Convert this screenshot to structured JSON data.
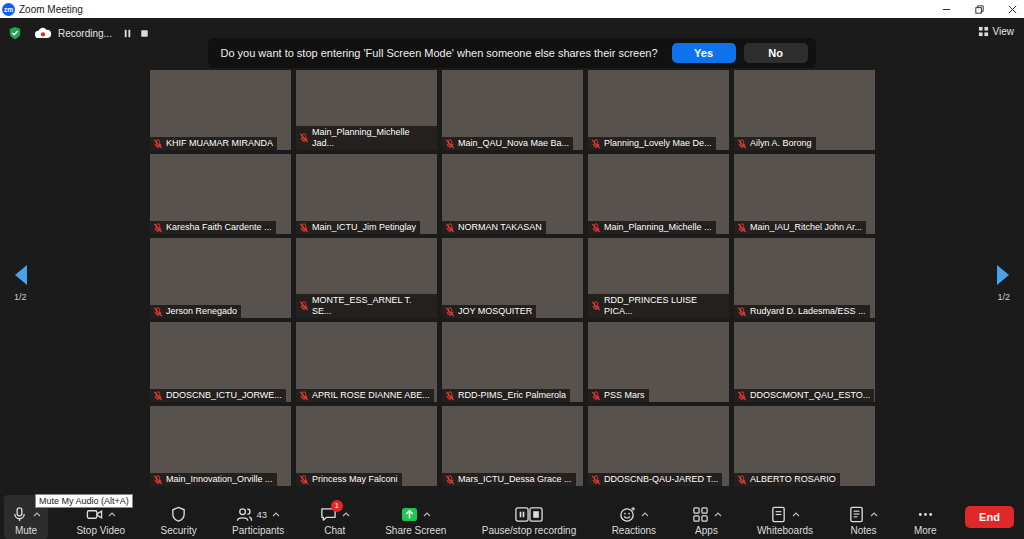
{
  "window": {
    "title": "Zoom Meeting",
    "logo": "zm"
  },
  "recording": {
    "label": "Recording..."
  },
  "banner": {
    "message": "Do you want to stop entering 'Full Screen Mode' when someone else shares their screen?",
    "buttons": [
      {
        "label": "Yes",
        "primary": true
      },
      {
        "label": "No",
        "primary": false
      }
    ]
  },
  "view": {
    "label": "View"
  },
  "pager": {
    "left": "1/2",
    "right": "1/2"
  },
  "tiles": [
    {
      "name": "KHIF MUAMAR MIRANDA",
      "muted": true
    },
    {
      "name": "Main_Planning_Michelle Jad...",
      "muted": true
    },
    {
      "name": "Main_QAU_Nova Mae Ba...",
      "muted": true
    },
    {
      "name": "Planning_Lovely Mae De...",
      "muted": true
    },
    {
      "name": "Ailyn A. Borong",
      "muted": true
    },
    {
      "name": "Karesha Faith Cardente ...",
      "muted": true
    },
    {
      "name": "Main_ICTU_Jim Petinglay",
      "muted": true
    },
    {
      "name": "NORMAN TAKASAN",
      "muted": true
    },
    {
      "name": "Main_Planning_Michelle ...",
      "muted": true
    },
    {
      "name": "Main_IAU_Ritchel John Ar...",
      "muted": true
    },
    {
      "name": "Jerson Renegado",
      "muted": true
    },
    {
      "name": "MONTE_ESS_ARNEL T. SE...",
      "muted": true
    },
    {
      "name": "JOY MOSQUITER",
      "muted": true
    },
    {
      "name": "RDD_PRINCES LUISE PICA...",
      "muted": true
    },
    {
      "name": "Rudyard D. Ladesma/ESS ...",
      "muted": true
    },
    {
      "name": "DDOSCNB_ICTU_JORWE...",
      "muted": true
    },
    {
      "name": "APRIL ROSE DIANNE ABE...",
      "muted": true
    },
    {
      "name": "RDD-PIMS_Eric Palmerola",
      "muted": true
    },
    {
      "name": "PSS Mars",
      "muted": true
    },
    {
      "name": "DDOSCMONT_QAU_ESTO...",
      "muted": true
    },
    {
      "name": "Main_Innovation_Orville ...",
      "muted": true
    },
    {
      "name": "Princess May Falconi",
      "muted": true
    },
    {
      "name": "Mars_ICTU_Dessa Grace ...",
      "muted": true
    },
    {
      "name": "DDOSCNB-QAU-JARED T...",
      "muted": true
    },
    {
      "name": "ALBERTO ROSARIO",
      "muted": true
    }
  ],
  "tooltip": {
    "text": "Mute My Audio (Alt+A)"
  },
  "toolbar": [
    {
      "label": "Mute",
      "kind": "mic",
      "menu": true,
      "hovered": true
    },
    {
      "label": "Stop Video",
      "kind": "video",
      "menu": true,
      "hovered": false
    },
    {
      "label": "Security",
      "kind": "shield",
      "menu": false,
      "hovered": false
    },
    {
      "label": "Participants",
      "kind": "people",
      "menu": true,
      "hovered": false,
      "count": "43"
    },
    {
      "label": "Chat",
      "kind": "chat",
      "menu": true,
      "hovered": false,
      "badge": "1"
    },
    {
      "label": "Share Screen",
      "kind": "share",
      "menu": true,
      "hovered": false
    },
    {
      "label": "Pause/stop recording",
      "kind": "record",
      "menu": false,
      "hovered": false
    },
    {
      "label": "Reactions",
      "kind": "smile",
      "menu": true,
      "hovered": false
    },
    {
      "label": "Apps",
      "kind": "apps",
      "menu": true,
      "hovered": false
    },
    {
      "label": "Whiteboards",
      "kind": "whiteboard",
      "menu": true,
      "hovered": false
    },
    {
      "label": "Notes",
      "kind": "notes",
      "menu": true,
      "hovered": false
    },
    {
      "label": "More",
      "kind": "more",
      "menu": false,
      "hovered": false
    }
  ],
  "end": {
    "label": "End"
  }
}
